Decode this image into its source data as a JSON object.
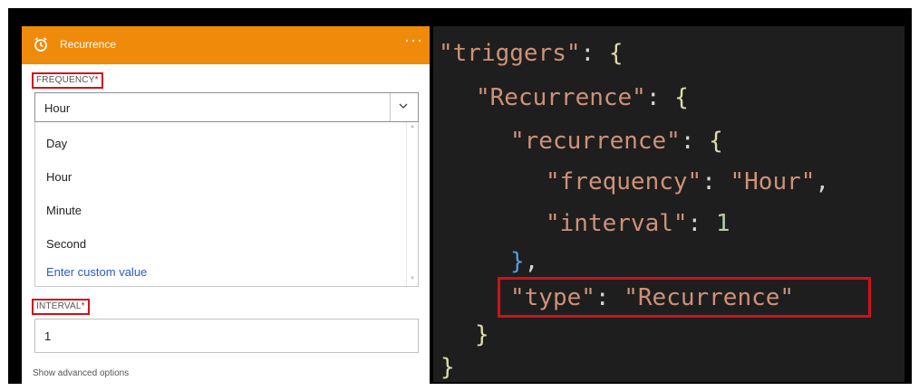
{
  "header": {
    "title": "Recurrence",
    "icon": "alarm-clock-icon",
    "more_label": "···",
    "color": "#f08a0b"
  },
  "frequency": {
    "label": "FREQUENCY",
    "required_mark": "*",
    "selected": "Hour",
    "options": [
      "Day",
      "Hour",
      "Minute",
      "Second"
    ],
    "custom_option": "Enter custom value"
  },
  "interval": {
    "label": "INTERVAL",
    "required_mark": "*",
    "value": "1"
  },
  "advanced_label": "Show advanced options",
  "code": {
    "l1_key": "\"triggers\"",
    "l1_punct": ": ",
    "l1_brace": "{",
    "l2_key": "\"Recurrence\"",
    "l2_punct": ": ",
    "l2_brace": "{",
    "l3_key": "\"recurrence\"",
    "l3_punct": ": ",
    "l3_brace": "{",
    "l4_key": "\"frequency\"",
    "l4_punct": ": ",
    "l4_value": "\"Hour\"",
    "l4_comma": ",",
    "l5_key": "\"interval\"",
    "l5_punct": ": ",
    "l5_value": "1",
    "l6_brace": "}",
    "l6_comma": ",",
    "l7_key": "\"type\"",
    "l7_punct": ": ",
    "l7_value": "\"Recurrence\"",
    "l8_brace": "}",
    "l9_brace": "}"
  },
  "colors": {
    "highlight_border": "#d0111b",
    "code_bg": "#1e1e1e",
    "string": "#ce9178",
    "number": "#b5cea8",
    "link": "#2a5cc9"
  }
}
